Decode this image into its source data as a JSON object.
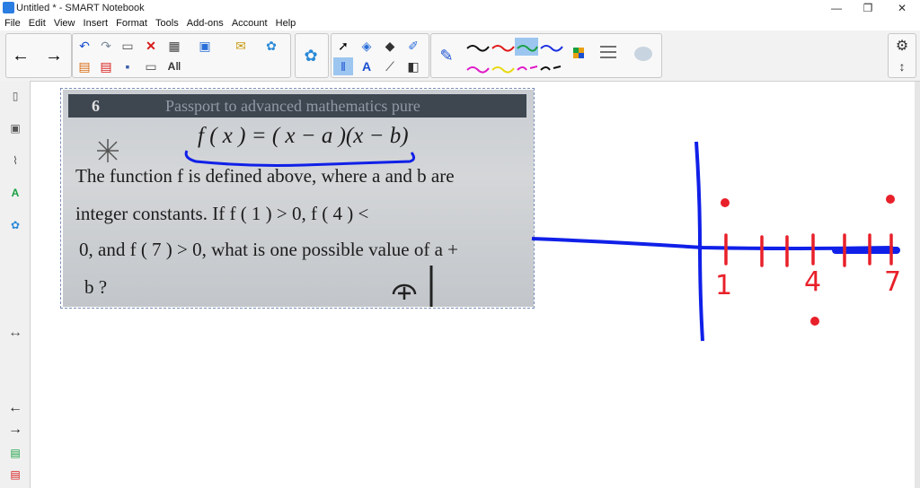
{
  "window": {
    "title": "Untitled * - SMART Notebook"
  },
  "menu": [
    "File",
    "Edit",
    "View",
    "Insert",
    "Format",
    "Tools",
    "Add-ons",
    "Account",
    "Help"
  ],
  "problem": {
    "number": "6",
    "header": "Passport to advanced mathematics pure",
    "formula": "f ( x ) = ( x − a )(x − b)",
    "lines": [
      "The function f is defined above, where a and b are",
      "integer constants. If f ( 1 ) > 0, f ( 4 ) <",
      "0, and f ( 7 ) > 0, what is one possible value of a +",
      "b ?"
    ]
  },
  "handwriting": {
    "axis_labels": [
      "1",
      "4",
      "7"
    ],
    "blue_color": "#1020e8",
    "red_color": "#e8202a"
  }
}
